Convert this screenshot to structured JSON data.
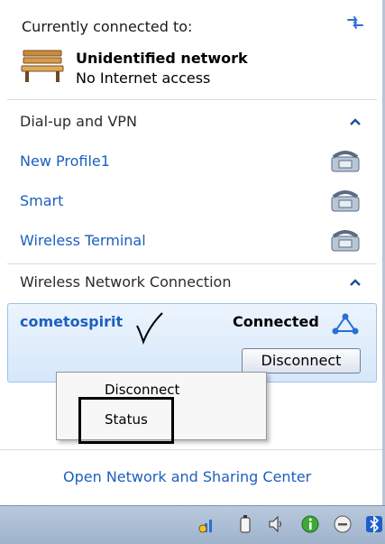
{
  "header": {
    "title": "Currently connected to:",
    "refresh_icon": "network-refresh-icon"
  },
  "current_network": {
    "icon": "public-network-bench-icon",
    "name": "Unidentified network",
    "status": "No Internet access"
  },
  "dialup_section": {
    "title": "Dial-up and VPN",
    "collapse_glyph": "^",
    "items": [
      {
        "label": "New Profile1",
        "icon": "dialup-phone-icon"
      },
      {
        "label": "Smart",
        "icon": "dialup-phone-icon"
      },
      {
        "label": "Wireless Terminal",
        "icon": "dialup-phone-icon"
      }
    ]
  },
  "wireless_section": {
    "title": "Wireless Network Connection",
    "collapse_glyph": "^",
    "connection": {
      "name": "cometospirit",
      "status": "Connected",
      "icon": "wireless-signal-icon",
      "button_label": "Disconnect"
    }
  },
  "context_menu": {
    "items": [
      "Disconnect",
      "Status"
    ]
  },
  "footer": {
    "link": "Open Network and Sharing Center"
  },
  "taskbar": {
    "icons": [
      "network-tray-icon",
      "battery-icon",
      "volume-icon",
      "info-icon",
      "minus-icon",
      "bluetooth-icon"
    ]
  },
  "colors": {
    "link_blue": "#1c5fbf",
    "selection_bg": "#dbe9fb",
    "taskbar": "#b0c2d8"
  }
}
